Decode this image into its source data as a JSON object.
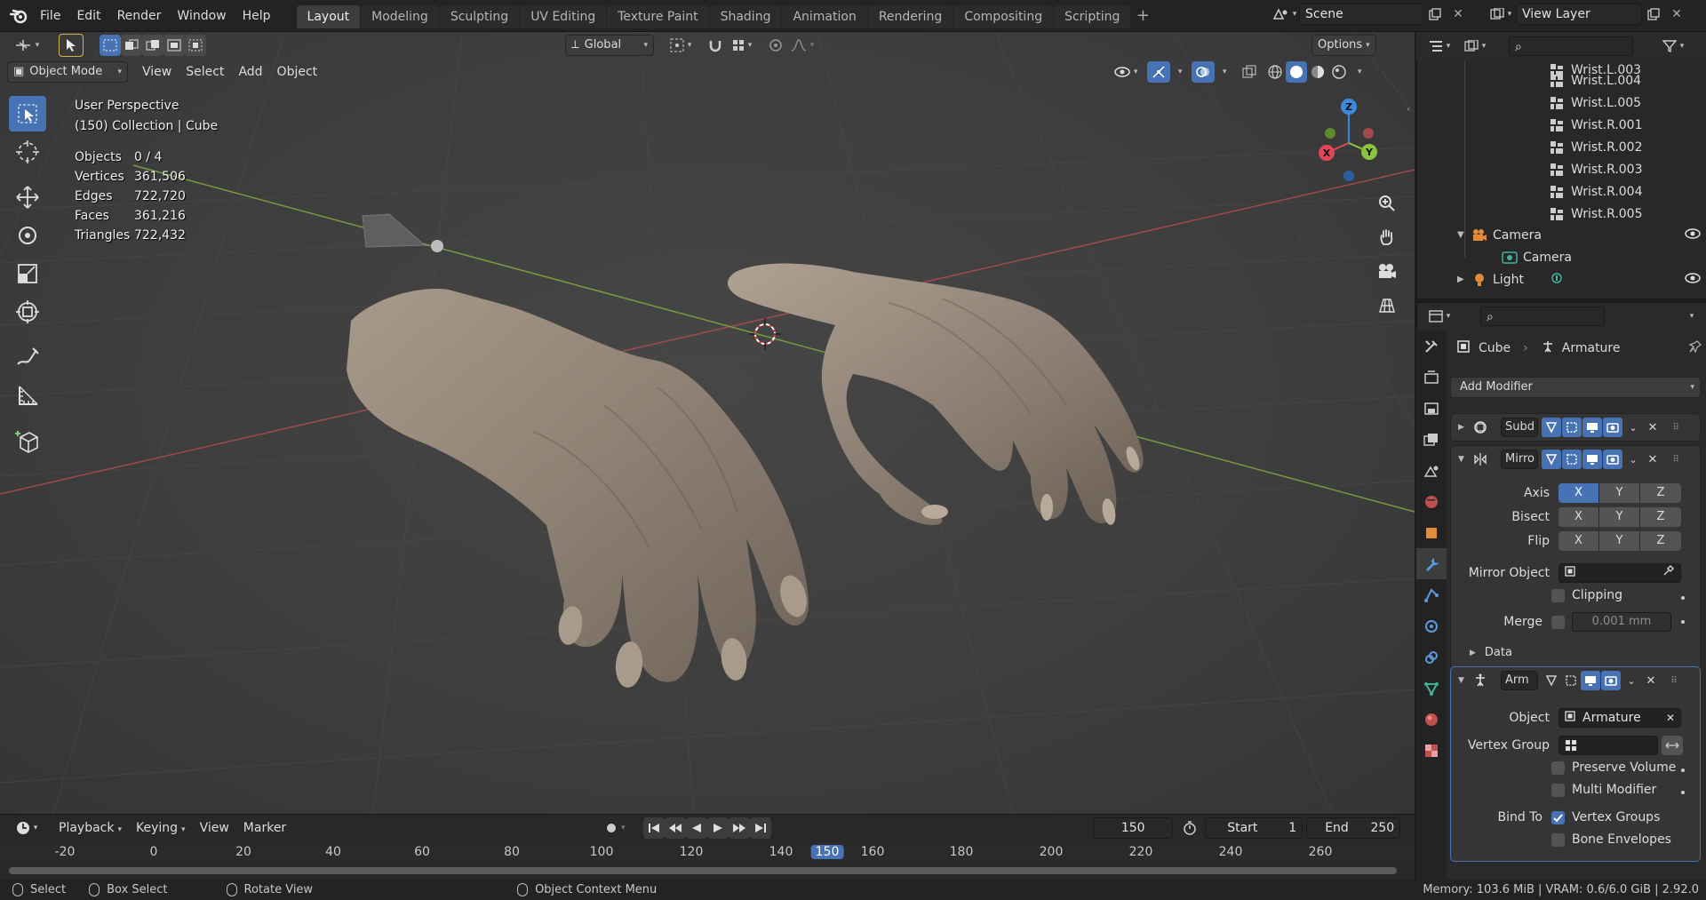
{
  "topbar": {
    "menus": [
      "File",
      "Edit",
      "Render",
      "Window",
      "Help"
    ],
    "workspaces": [
      "Layout",
      "Modeling",
      "Sculpting",
      "UV Editing",
      "Texture Paint",
      "Shading",
      "Animation",
      "Rendering",
      "Compositing",
      "Scripting"
    ],
    "active_workspace": "Layout",
    "scene": "Scene",
    "view_layer": "View Layer"
  },
  "viewport": {
    "orientation": "Global",
    "options_label": "Options",
    "mode": "Object Mode",
    "menus": [
      "View",
      "Select",
      "Add",
      "Object"
    ],
    "view_name": "User Perspective",
    "context": "(150) Collection | Cube",
    "stats": [
      {
        "k": "Objects",
        "v": "0 / 4"
      },
      {
        "k": "Vertices",
        "v": "361,506"
      },
      {
        "k": "Edges",
        "v": "722,720"
      },
      {
        "k": "Faces",
        "v": "361,216"
      },
      {
        "k": "Triangles",
        "v": "722,432"
      }
    ],
    "gizmo_axes": {
      "x": "X",
      "y": "Y",
      "z": "Z"
    }
  },
  "timeline": {
    "menus": [
      "Playback",
      "Keying",
      "View",
      "Marker"
    ],
    "current_frame": "150",
    "start_label": "Start",
    "start": "1",
    "end_label": "End",
    "end": "250",
    "ticks": [
      "-20",
      "0",
      "20",
      "40",
      "60",
      "80",
      "100",
      "120",
      "140",
      "150",
      "160",
      "180",
      "200",
      "220",
      "240",
      "260"
    ]
  },
  "statusbar": {
    "select": "Select",
    "box_select": "Box Select",
    "rotate_view": "Rotate View",
    "context_menu": "Object Context Menu",
    "memory": "Memory: 103.6 MiB | VRAM: 0.6/6.0 GiB | 2.92.0"
  },
  "outliner": {
    "bones": [
      "Wrist.L.003",
      "Wrist.L.004",
      "Wrist.L.005",
      "Wrist.R.001",
      "Wrist.R.002",
      "Wrist.R.003",
      "Wrist.R.004",
      "Wrist.R.005"
    ],
    "camera_obj": "Camera",
    "camera_data": "Camera",
    "light_obj": "Light"
  },
  "properties": {
    "object": "Cube",
    "active_modifier": "Armature",
    "add_modifier": "Add Modifier",
    "subd_name": "Subd",
    "mirror_name": "Mirro",
    "axis_label": "Axis",
    "bisect_label": "Bisect",
    "flip_label": "Flip",
    "xyz": [
      "X",
      "Y",
      "Z"
    ],
    "mirror_object_label": "Mirror Object",
    "clipping": "Clipping",
    "merge_label": "Merge",
    "merge_value": "0.001 mm",
    "data_label": "Data",
    "arm_name": "Arm",
    "object_label": "Object",
    "object_value": "Armature",
    "vertex_group_label": "Vertex Group",
    "preserve_volume": "Preserve Volume",
    "multi_modifier": "Multi Modifier",
    "bind_to_label": "Bind To",
    "vertex_groups": "Vertex Groups",
    "bone_envelopes": "Bone Envelopes"
  },
  "colors": {
    "accent": "#4772b3",
    "x_axis": "#e04656",
    "y_axis": "#8ac53d",
    "z_axis": "#3b8ae0"
  }
}
